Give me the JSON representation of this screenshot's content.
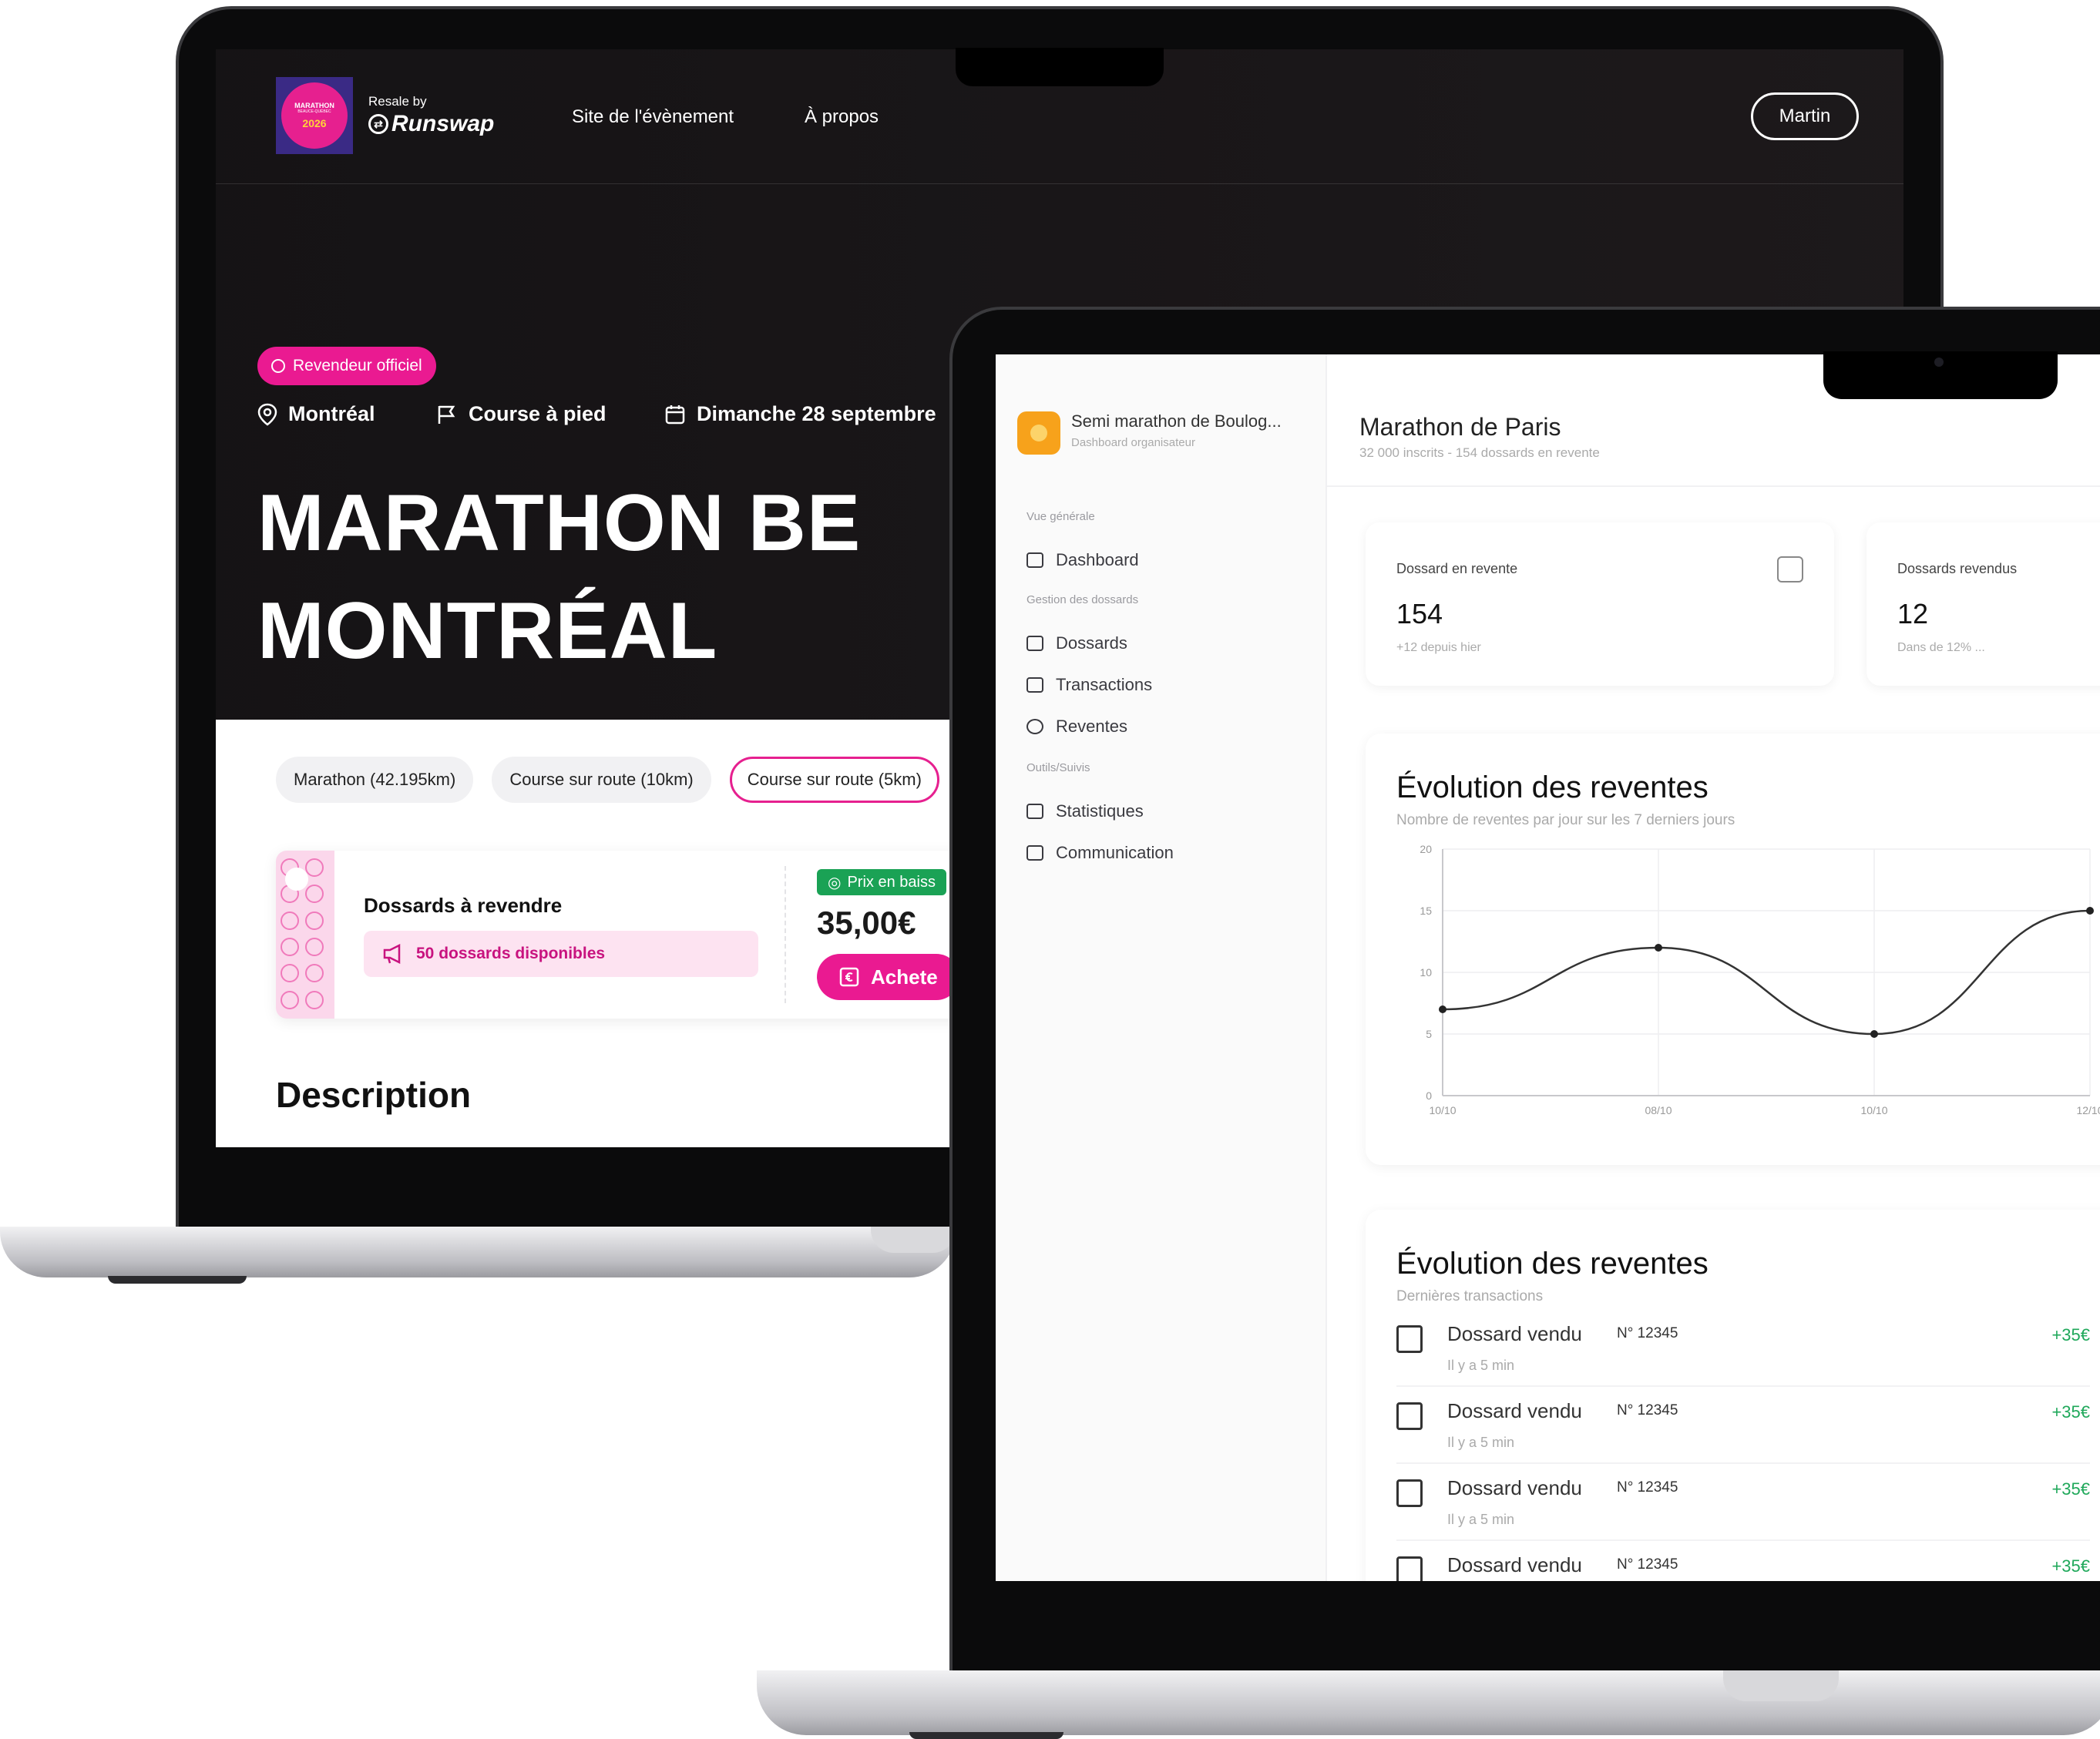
{
  "event_page": {
    "logo": {
      "line1": "MARATHON",
      "line2": "BEAUCE-QUÉBEC",
      "year": "2026"
    },
    "resale_by": "Resale by",
    "brand": "Runswap",
    "nav": {
      "event_site": "Site de l'évènement",
      "about": "À propos"
    },
    "user_button": "Martin",
    "badge": "Revendeur officiel",
    "meta": {
      "city": "Montréal",
      "sport": "Course à pied",
      "date": "Dimanche 28 septembre"
    },
    "title": "MARATHON BE\nMONTRÉAL",
    "distances": [
      {
        "label": "Marathon (42.195km)",
        "active": false
      },
      {
        "label": "Course sur route (10km)",
        "active": false
      },
      {
        "label": "Course sur route (5km)",
        "active": true
      }
    ],
    "card": {
      "title": "Dossards à revendre",
      "available": "50 dossards disponibles",
      "price_badge": "Prix en baiss",
      "price": "35,00€",
      "buy": "Achete"
    },
    "description_title": "Description"
  },
  "dashboard": {
    "org_name": "Semi marathon de Boulog...",
    "org_sub": "Dashboard organisateur",
    "sidebar": {
      "section_overview": "Vue générale",
      "dashboard": "Dashboard",
      "section_bibs": "Gestion des dossards",
      "bibs": "Dossards",
      "transactions": "Transactions",
      "resale": "Reventes",
      "section_tools": "Outils/Suivis",
      "stats": "Statistiques",
      "communication": "Communication"
    },
    "title": "Marathon de Paris",
    "subtitle": "32 000 inscrits - 154 dossards en revente",
    "stats": [
      {
        "label": "Dossard en revente",
        "value": "154",
        "sub": "+12 depuis hier"
      },
      {
        "label": "Dossards revendus",
        "value": "12",
        "sub": "Dans de 12% ..."
      }
    ],
    "chart_panel": {
      "title": "Évolution des reventes",
      "subtitle": "Nombre de reventes par jour sur les 7 derniers jours"
    },
    "tx_panel": {
      "title": "Évolution des reventes",
      "subtitle": "Dernières transactions"
    },
    "transactions": [
      {
        "title": "Dossard vendu",
        "number": "N° 12345",
        "time": "Il y a 5 min",
        "amount": "+35€"
      },
      {
        "title": "Dossard vendu",
        "number": "N° 12345",
        "time": "Il y a 5 min",
        "amount": "+35€"
      },
      {
        "title": "Dossard vendu",
        "number": "N° 12345",
        "time": "Il y a 5 min",
        "amount": "+35€"
      },
      {
        "title": "Dossard vendu",
        "number": "N° 12345",
        "time": "",
        "amount": "+35€"
      }
    ]
  },
  "chart_data": {
    "type": "line",
    "title": "Évolution des reventes",
    "x": [
      "10/10",
      "08/10",
      "10/10",
      "12/10"
    ],
    "y_ticks": [
      0,
      5,
      10,
      15,
      20
    ],
    "ylim": [
      0,
      20
    ],
    "series": [
      {
        "values": [
          7,
          12,
          5,
          15
        ]
      }
    ],
    "grid": true
  },
  "colors": {
    "brand_pink": "#ea1a91",
    "green": "#1aa255",
    "orange": "#f7a21b"
  }
}
